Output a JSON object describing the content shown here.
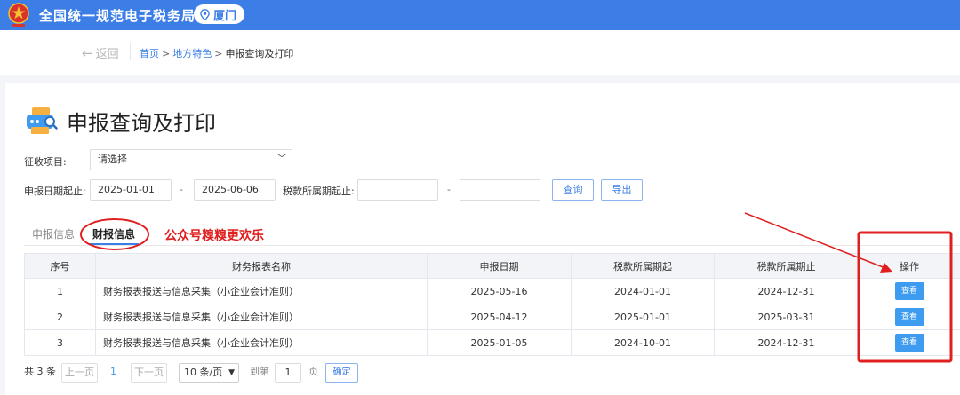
{
  "header": {
    "app_title": "全国统一规范电子税务局",
    "region": "厦门",
    "brand_color": "#3d7ee6"
  },
  "nav": {
    "back_label": "返回",
    "breadcrumb": [
      "首页",
      "地方特色",
      "申报查询及打印"
    ]
  },
  "page": {
    "title": "申报查询及打印"
  },
  "filters": {
    "levy_item_label": "征收项目:",
    "levy_item_value": "请选择",
    "declare_date_label": "申报日期起止:",
    "declare_date_from": "2025-01-01",
    "declare_date_to": "2025-06-06",
    "range_sep": "-",
    "tax_period_label": "税款所属期起止:",
    "tax_period_from": "",
    "tax_period_to": "",
    "query_button": "查询",
    "export_button": "导出"
  },
  "tabs": [
    {
      "label": "申报信息",
      "active": false
    },
    {
      "label": "财报信息",
      "active": true
    }
  ],
  "annotation": {
    "watermark_text": "公众号糗糗更欢乐",
    "highlight_color": "#e02020"
  },
  "table": {
    "columns": [
      "序号",
      "财务报表名称",
      "申报日期",
      "税款所属期起",
      "税款所属期止",
      "操作"
    ],
    "rows": [
      {
        "index": "1",
        "name": "财务报表报送与信息采集（小企业会计准则）",
        "declare_date": "2025-05-16",
        "period_start": "2024-01-01",
        "period_end": "2024-12-31",
        "action": "查看"
      },
      {
        "index": "2",
        "name": "财务报表报送与信息采集（小企业会计准则）",
        "declare_date": "2025-04-12",
        "period_start": "2025-01-01",
        "period_end": "2025-03-31",
        "action": "查看"
      },
      {
        "index": "3",
        "name": "财务报表报送与信息采集（小企业会计准则）",
        "declare_date": "2025-01-05",
        "period_start": "2024-10-01",
        "period_end": "2024-12-31",
        "action": "查看"
      }
    ]
  },
  "pagination": {
    "total": "共 3 条",
    "prev": "上一页",
    "current_page": "1",
    "next": "下一页",
    "page_size": "10 条/页",
    "goto_prefix": "到第",
    "goto_value": "1",
    "goto_suffix": "页",
    "confirm": "确定"
  }
}
